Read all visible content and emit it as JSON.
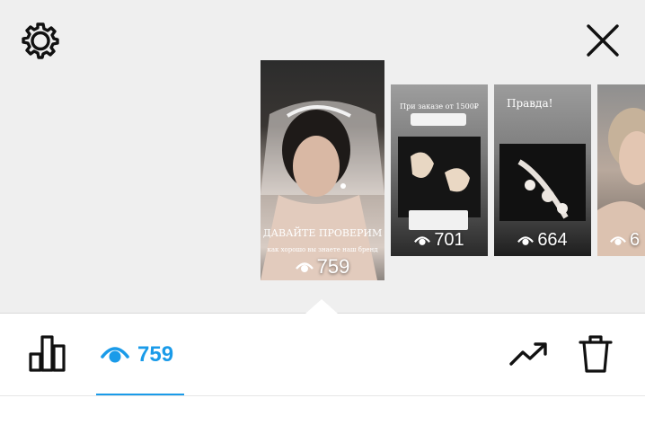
{
  "toolbar": {
    "settings_icon": "gear-icon",
    "close_icon": "close-icon"
  },
  "stories": [
    {
      "views": "759",
      "caption_title": "ДАВАЙТЕ ПРОВЕРИМ",
      "caption_sub": "как хорошо вы знаете наш бренд"
    },
    {
      "views": "701",
      "caption_title": "При заказе от 1500₽"
    },
    {
      "views": "664",
      "caption_title": "Правда!"
    },
    {
      "views": "6"
    }
  ],
  "bottom_bar": {
    "views_count": "759",
    "icons": [
      "bar-chart-icon",
      "eye-icon",
      "trending-up-icon",
      "trash-icon"
    ]
  },
  "colors": {
    "accent": "#1a9be9",
    "background": "#efefef"
  }
}
